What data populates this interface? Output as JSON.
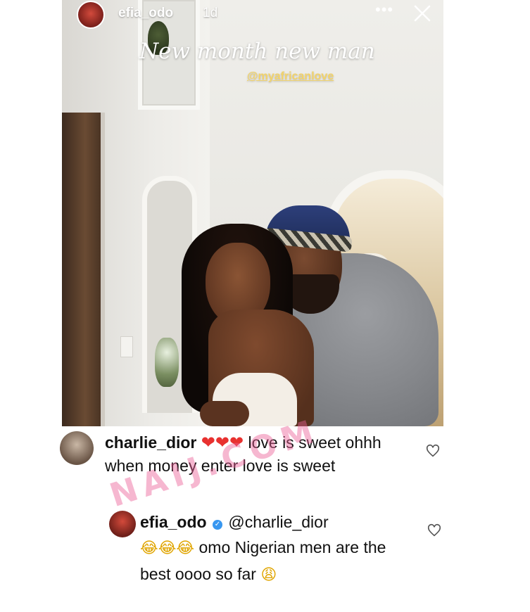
{
  "story": {
    "username": "efia_odo",
    "time": "1d",
    "more_icon": "more-horizontal-icon",
    "close_icon": "close-icon",
    "caption": "New month new man",
    "mention": "@myafricanlove"
  },
  "comments": [
    {
      "username": "charlie_dior",
      "hearts": "❤❤❤",
      "text": "love is sweet ohhh when money enter love is sweet",
      "like_icon": "heart-outline-icon"
    },
    {
      "username": "efia_odo",
      "verified_icon": "verified-badge-icon",
      "mention": "@charlie_dior",
      "emoji_lead": "😂😂😂",
      "text": "omo Nigerian men are the best oooo so far",
      "emoji_trail": "😩",
      "like_icon": "heart-outline-icon"
    }
  ],
  "watermark": "NAIJ.COM"
}
